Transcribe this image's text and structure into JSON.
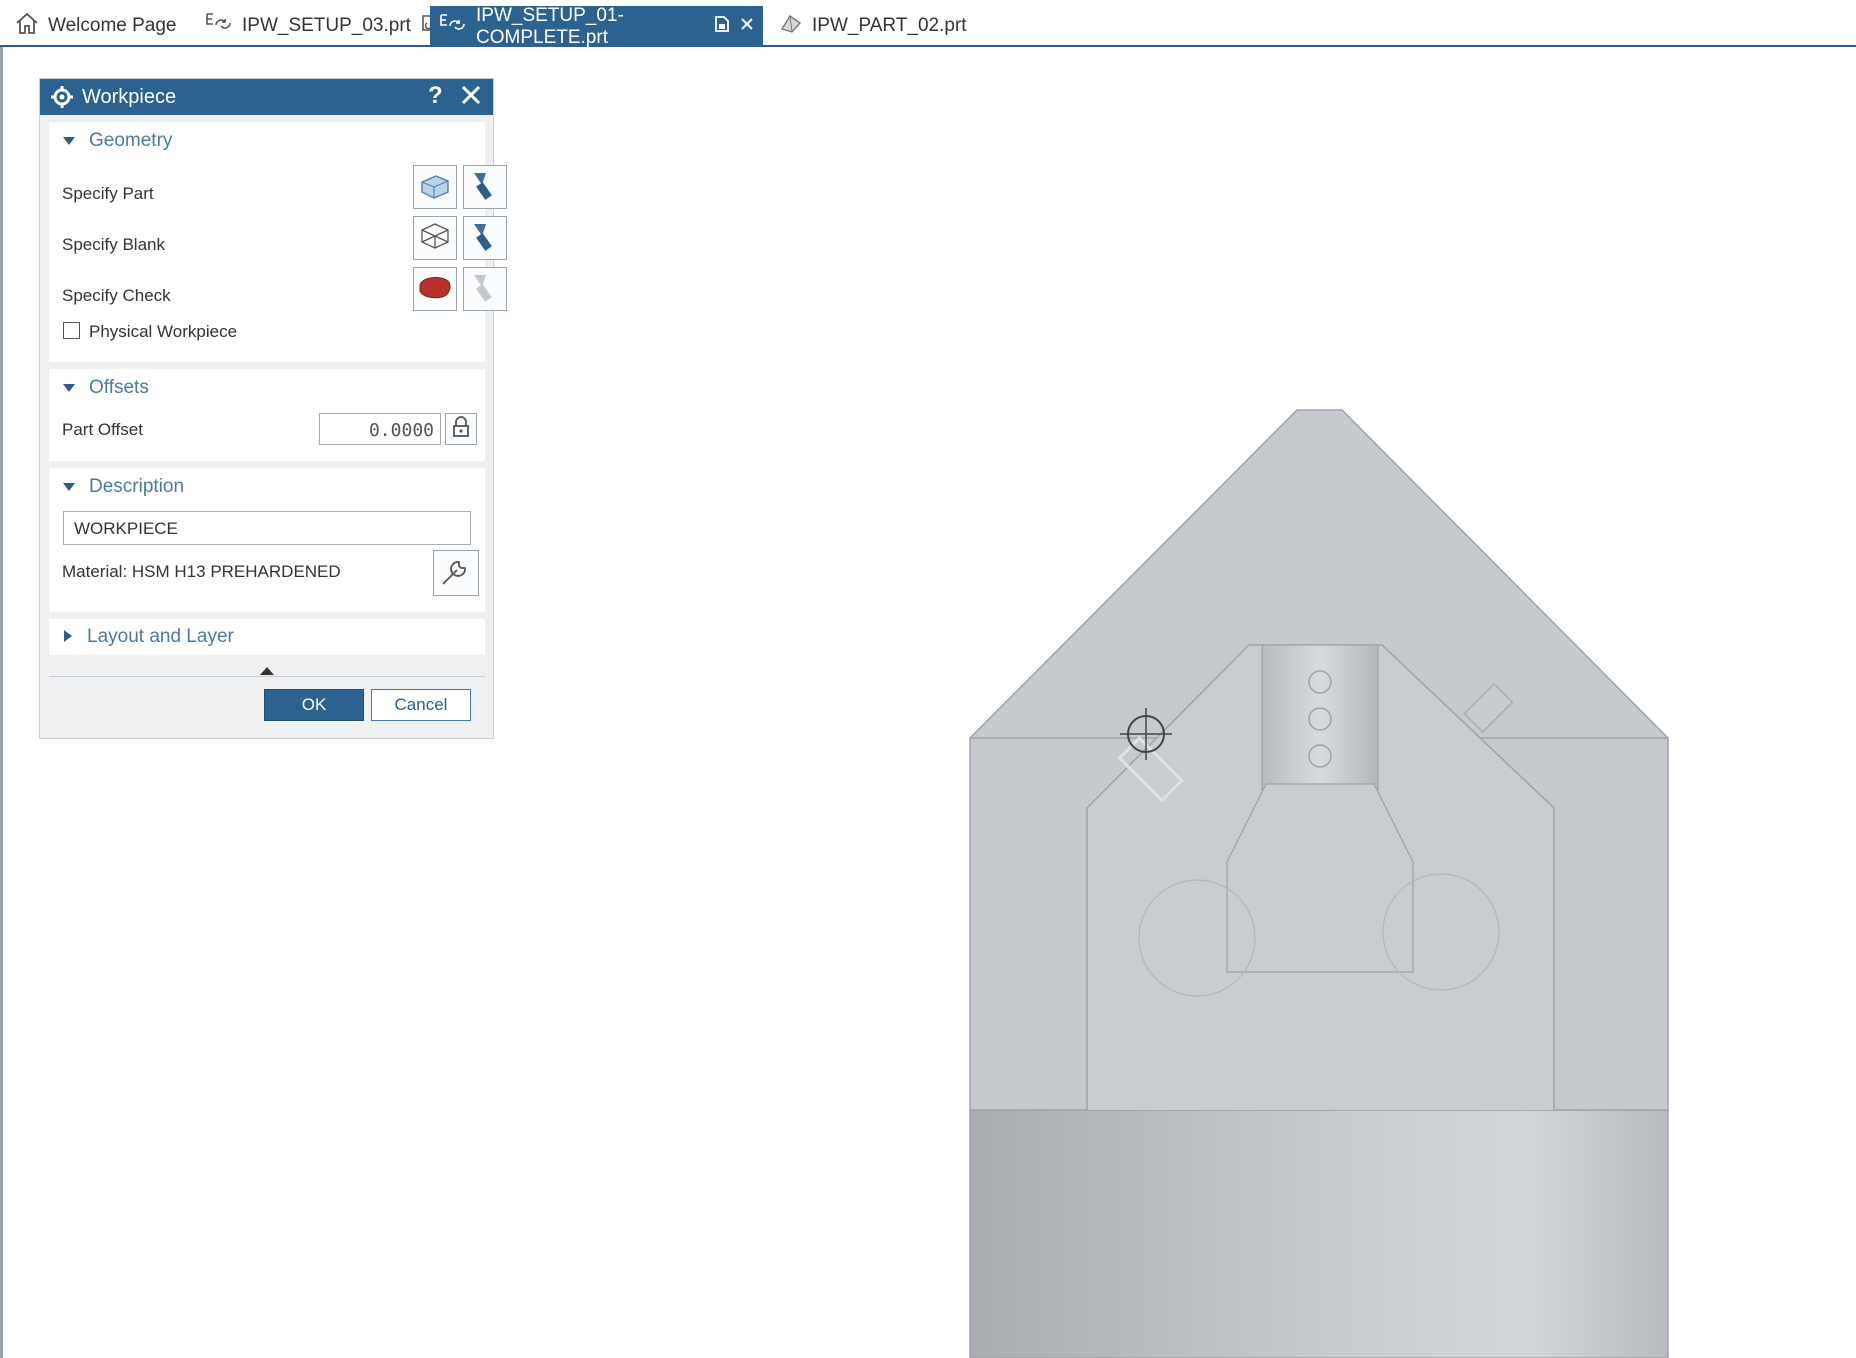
{
  "tabs": [
    {
      "label": "Welcome Page",
      "icon": "home-icon"
    },
    {
      "label": "IPW_SETUP_03.prt",
      "icon": "assembly-file-icon"
    },
    {
      "label": "IPW_SETUP_01-COMPLETE.prt",
      "icon": "assembly-file-icon",
      "active": true
    },
    {
      "label": "IPW_PART_02.prt",
      "icon": "part-file-icon"
    }
  ],
  "dialog": {
    "title": "Workpiece",
    "help_label": "?",
    "geometry": {
      "header": "Geometry",
      "specify_part": "Specify Part",
      "specify_blank": "Specify Blank",
      "specify_check": "Specify Check",
      "physical_workpiece": "Physical Workpiece",
      "physical_workpiece_checked": false
    },
    "offsets": {
      "header": "Offsets",
      "part_offset_label": "Part Offset",
      "part_offset_value": "0.0000"
    },
    "description": {
      "header": "Description",
      "value": "WORKPIECE",
      "material": "Material: HSM H13 PREHARDENED"
    },
    "layout_and_layer": {
      "header": "Layout and Layer",
      "expanded": false
    },
    "ok_label": "OK",
    "cancel_label": "Cancel"
  },
  "colors": {
    "accent": "#2b6290",
    "section_header": "#4a79a8",
    "check_body": "#c0302c",
    "model_gray": "#c4c8cc"
  }
}
